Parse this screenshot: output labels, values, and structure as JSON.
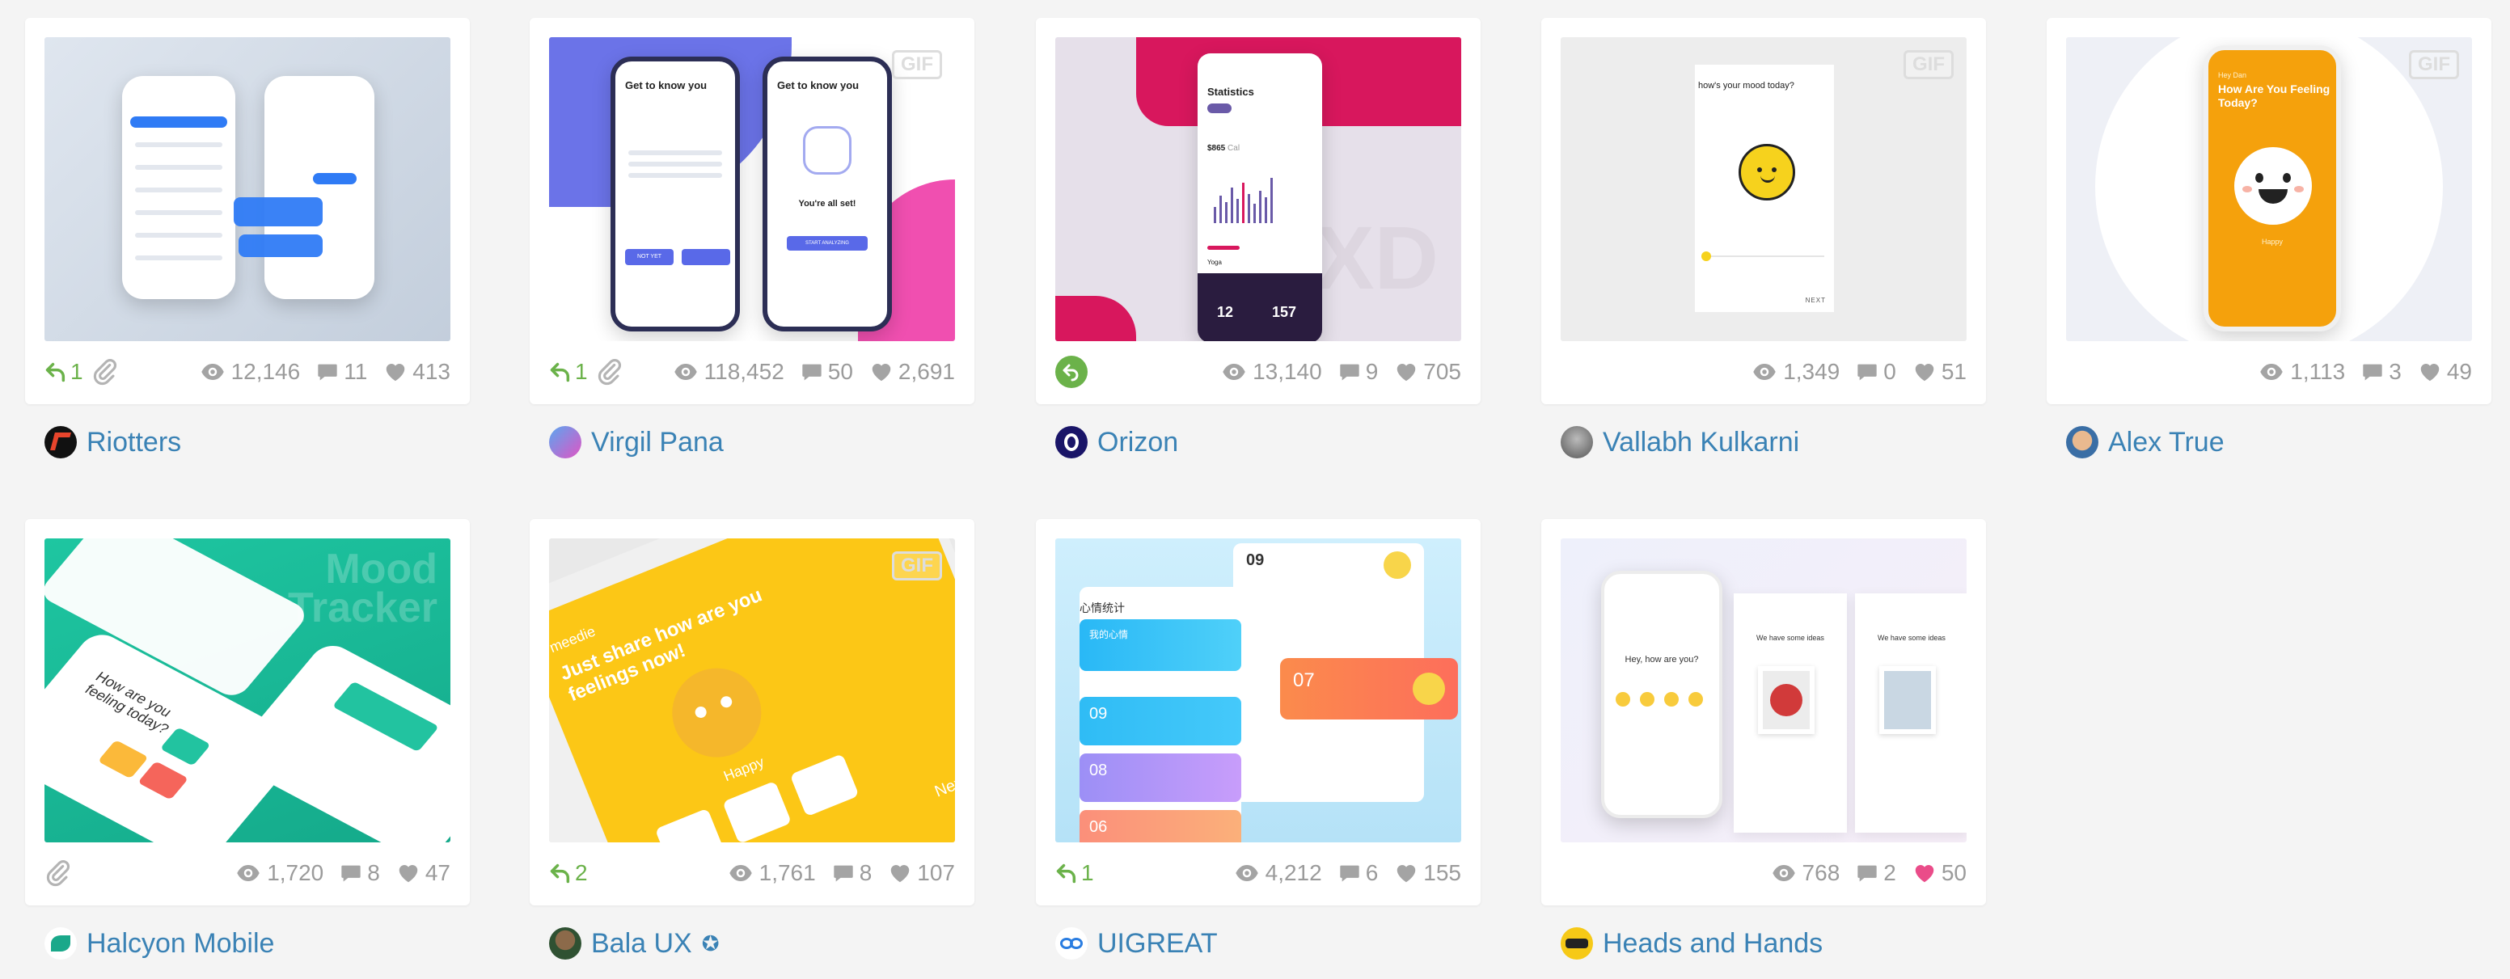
{
  "icons": {
    "rebound": "rebound-arrow-icon",
    "attachment": "paperclip-icon",
    "views": "eye-icon",
    "comments": "comment-bubble-icon",
    "likes": "heart-icon"
  },
  "colors": {
    "link": "#3a82b5",
    "muted": "#9b9b9b",
    "rebound": "#6bb24a",
    "liked": "#ea4c89"
  },
  "shots": [
    {
      "author": "Riotters",
      "rebounds": "1",
      "views": "12,146",
      "comments": "11",
      "likes": "413",
      "gif": false,
      "attachment": true,
      "liked": false
    },
    {
      "author": "Virgil Pana",
      "rebounds": "1",
      "views": "118,452",
      "comments": "50",
      "likes": "2,691",
      "gif": true,
      "gif_label": "GIF",
      "attachment": true,
      "liked": false,
      "screen": {
        "title": "Get to know you",
        "status": "You're all set!",
        "btn_left": "NOT YET",
        "btn_right": "START ANALYZING"
      }
    },
    {
      "author": "Orizon",
      "rebounds": "",
      "views": "13,140",
      "comments": "9",
      "likes": "705",
      "gif": false,
      "attachment": false,
      "liked": false,
      "screen": {
        "title": "Statistics",
        "amount": "$865",
        "unit": "Cal",
        "item": "Yoga",
        "num1": "12",
        "num2": "157",
        "watermark": "XD"
      }
    },
    {
      "author": "Vallabh Kulkarni",
      "views": "1,349",
      "comments": "0",
      "likes": "51",
      "gif": true,
      "gif_label": "GIF",
      "attachment": false,
      "liked": false,
      "screen": {
        "question": "how's your mood today?",
        "next": "NEXT"
      }
    },
    {
      "author": "Alex True",
      "views": "1,113",
      "comments": "3",
      "likes": "49",
      "gif": true,
      "gif_label": "GIF",
      "attachment": false,
      "liked": false,
      "screen": {
        "greeting": "Hey Dan",
        "question": "How Are You Feeling Today?",
        "mood": "Happy"
      }
    },
    {
      "author": "Halcyon Mobile",
      "views": "1,720",
      "comments": "8",
      "likes": "47",
      "gif": false,
      "attachment": true,
      "liked": false,
      "screen": {
        "title_line1": "Mood",
        "title_line2": "Tracker",
        "question": "How are you feeling today?"
      }
    },
    {
      "author": "Bala UX",
      "rebounds": "2",
      "views": "1,761",
      "comments": "8",
      "likes": "107",
      "gif": true,
      "gif_label": "GIF",
      "attachment": false,
      "liked": false,
      "badge": "✪",
      "screen": {
        "brand": "meedie",
        "headline": "Just share how are you feelings now!",
        "mood": "Happy",
        "next": "Next"
      }
    },
    {
      "author": "UIGREAT",
      "rebounds": "1",
      "views": "4,212",
      "comments": "6",
      "likes": "155",
      "gif": false,
      "attachment": false,
      "liked": false,
      "screen": {
        "day_top": "09",
        "label": "心情统计",
        "card_title": "我的心情",
        "d1": "09",
        "d2": "08",
        "d3": "06",
        "big_day": "07"
      }
    },
    {
      "author": "Heads and Hands",
      "views": "768",
      "comments": "2",
      "likes": "50",
      "gif": false,
      "attachment": false,
      "liked": true,
      "screen": {
        "greeting": "Hey, how are you?",
        "ideas": "We have some ideas"
      }
    }
  ]
}
